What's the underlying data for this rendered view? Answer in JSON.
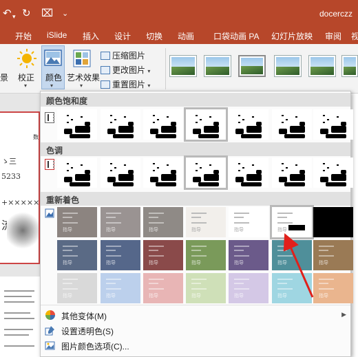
{
  "window": {
    "title": "docerczz"
  },
  "quick_access": {
    "undo_glyph": "↶",
    "undo_caret": "▾",
    "redo_glyph": "↻",
    "present_glyph": "⌧",
    "customize_glyph": "⌄"
  },
  "tabs": [
    "开始",
    "iSlide",
    "插入",
    "设计",
    "切换",
    "动画",
    "口袋动画 PA",
    "幻灯片放映",
    "审阅",
    "视"
  ],
  "ribbon": {
    "partial_label": "景",
    "correct": "校正",
    "color": "颜色",
    "art_effects": "艺术效果",
    "compress": "压缩图片",
    "change": "更改图片",
    "reset": "重置图片",
    "caret": "▾"
  },
  "dropdown": {
    "sections": [
      {
        "title": "颜色饱和度"
      },
      {
        "title": "色调"
      },
      {
        "title": "重新着色"
      }
    ],
    "menu": [
      {
        "label": "其他变体(M)",
        "submenu_arrow": "▶"
      },
      {
        "label": "设置透明色(S)"
      },
      {
        "label": "图片颜色选项(C)..."
      }
    ],
    "recolor_caption": "指导"
  },
  "slide": {
    "lines": [
      "ゝ三",
      "5233",
      "+××××××",
      "流"
    ],
    "caption": "数"
  },
  "colors": {
    "accent": "#b7472a",
    "recolor_row1": [
      "#8c8480",
      "#9a9392",
      "#8f8a86",
      "#f2efeb",
      "#ffffff",
      "#ffffff",
      "#000000"
    ],
    "recolor_row2": [
      "#5a6a85",
      "#55678a",
      "#8a4a4a",
      "#7a9a5a",
      "#6b5a8a",
      "#4f8f9a",
      "#9a7a55"
    ],
    "recolor_row3": [
      "#d9d9d9",
      "#bcd0ec",
      "#e8b5b5",
      "#cfe0b8",
      "#d4c8e6",
      "#9fd6e2",
      "#eab58e"
    ]
  }
}
